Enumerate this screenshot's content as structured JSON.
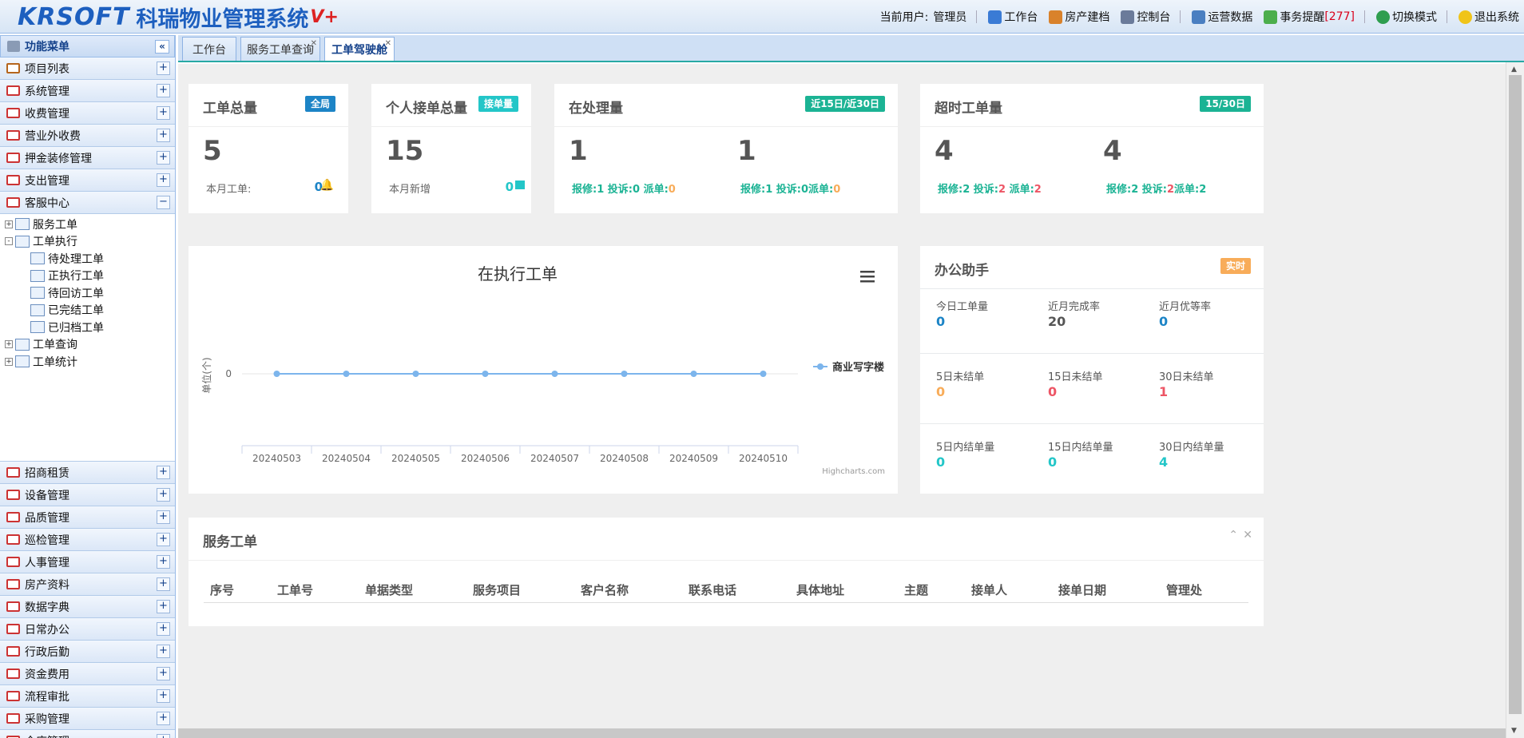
{
  "app": {
    "logo_en": "KRSOFT",
    "logo_cn": "科瑞物业管理系统",
    "logo_ver": "V+"
  },
  "topnav": {
    "current_user_label": "当前用户:",
    "current_user": "管理员",
    "workbench": "工作台",
    "property_archive": "房产建档",
    "console": "控制台",
    "operations": "运营数据",
    "reminders": "事务提醒",
    "reminders_count": "[277]",
    "switch_mode": "切换模式",
    "logout": "退出系统"
  },
  "sidebar": {
    "title": "功能菜单",
    "top_items": [
      "项目列表",
      "系统管理",
      "收费管理",
      "营业外收费",
      "押金装修管理",
      "支出管理",
      "客服中心"
    ],
    "tree": [
      {
        "label": "服务工单",
        "level": 1,
        "expander": "+"
      },
      {
        "label": "工单执行",
        "level": 1,
        "expander": "−"
      },
      {
        "label": "待处理工单",
        "level": 2
      },
      {
        "label": "正执行工单",
        "level": 2
      },
      {
        "label": "待回访工单",
        "level": 2
      },
      {
        "label": "已完结工单",
        "level": 2
      },
      {
        "label": "已归档工单",
        "level": 2
      },
      {
        "label": "工单查询",
        "level": 1,
        "expander": "+"
      },
      {
        "label": "工单统计",
        "level": 1,
        "expander": "+"
      }
    ],
    "bottom_items": [
      "招商租赁",
      "设备管理",
      "品质管理",
      "巡检管理",
      "人事管理",
      "房产资料",
      "数据字典",
      "日常办公",
      "行政后勤",
      "资金费用",
      "流程审批",
      "采购管理",
      "仓库管理"
    ]
  },
  "tabs": [
    {
      "label": "工作台",
      "closable": false,
      "active": false
    },
    {
      "label": "服务工单查询",
      "closable": true,
      "active": false
    },
    {
      "label": "工单驾驶舱",
      "closable": true,
      "active": true
    }
  ],
  "cards": {
    "total": {
      "title": "工单总量",
      "badge": "全局",
      "value": "5",
      "sub": "本月工单:",
      "sub_value": "0"
    },
    "personal": {
      "title": "个人接单总量",
      "badge": "接单量",
      "value": "15",
      "sub": "本月新增",
      "sub_value": "0"
    },
    "processing": {
      "title": "在处理量",
      "badge": "近15日/近30日",
      "left": {
        "value": "1",
        "repair": "报修:1",
        "complaint": "投诉:0",
        "dispatch_label": "派单:",
        "dispatch": "0"
      },
      "right": {
        "value": "1",
        "repair": "报修:1",
        "complaint": "投诉:0",
        "dispatch_label": "派单:",
        "dispatch": "0"
      }
    },
    "overtime": {
      "title": "超时工单量",
      "badge": "15/30日",
      "left": {
        "value": "4",
        "repair": "报修:2",
        "complaint_label": "投诉:",
        "complaint": "2",
        "dispatch_label": "派单:",
        "dispatch": "2"
      },
      "right": {
        "value": "4",
        "repair": "报修:2",
        "complaint_label": "投诉:",
        "complaint": "2",
        "dispatch_label": "派单:",
        "dispatch": "2"
      }
    }
  },
  "chart_data": {
    "type": "line",
    "title": "在执行工单",
    "xlabel": "",
    "ylabel": "单位(个)",
    "categories": [
      "20240503",
      "20240504",
      "20240505",
      "20240506",
      "20240507",
      "20240508",
      "20240509",
      "20240510"
    ],
    "series": [
      {
        "name": "商业写字楼",
        "values": [
          0,
          0,
          0,
          0,
          0,
          0,
          0,
          0
        ]
      }
    ],
    "yticks": [
      "0"
    ],
    "legend": "right",
    "credits": "Highcharts.com",
    "color": "#7cb5ec"
  },
  "assistant": {
    "title": "办公助手",
    "badge": "实时",
    "rows": [
      [
        {
          "label": "今日工单量",
          "value": "0",
          "color": "b"
        },
        {
          "label": "近月完成率",
          "value": "20",
          "color": "d"
        },
        {
          "label": "近月优等率",
          "value": "0",
          "color": "b"
        }
      ],
      [
        {
          "label": "5日未结单",
          "value": "0",
          "color": "o"
        },
        {
          "label": "15日未结单",
          "value": "0",
          "color": "r"
        },
        {
          "label": "30日未结单",
          "value": "1",
          "color": "r"
        }
      ],
      [
        {
          "label": "5日内结单量",
          "value": "0",
          "color": "c"
        },
        {
          "label": "15日内结单量",
          "value": "0",
          "color": "c"
        },
        {
          "label": "30日内结单量",
          "value": "4",
          "color": "c"
        }
      ]
    ]
  },
  "service_orders": {
    "title": "服务工单",
    "columns": [
      "序号",
      "工单号",
      "单据类型",
      "服务项目",
      "客户名称",
      "联系电话",
      "具体地址",
      "主题",
      "接单人",
      "接单日期",
      "管理处"
    ]
  }
}
